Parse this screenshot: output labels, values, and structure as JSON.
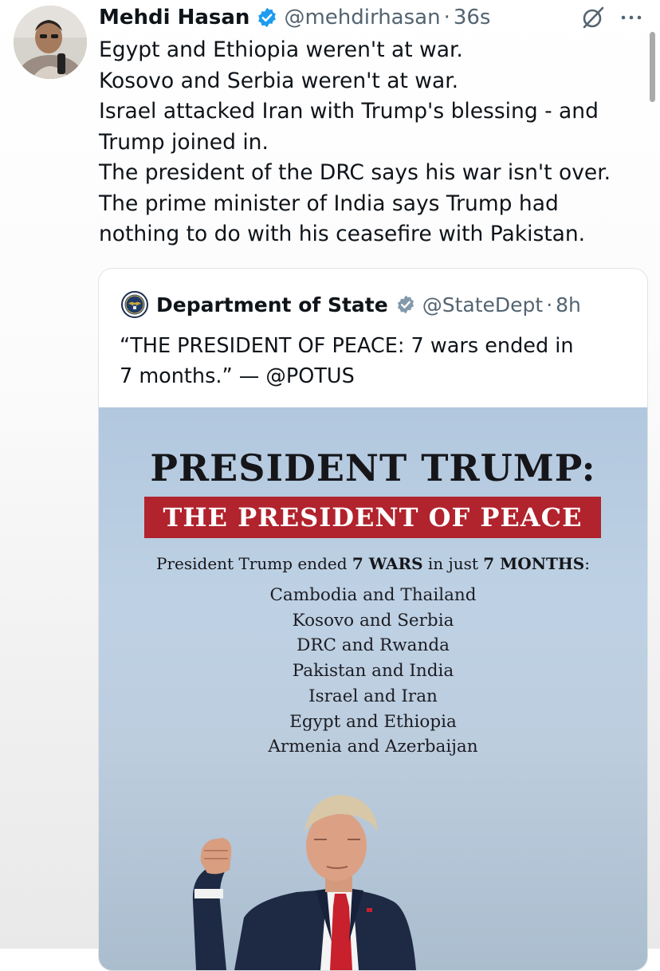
{
  "tweet": {
    "author_name": "Mehdi Hasan",
    "handle": "@mehdirhasan",
    "separator": "·",
    "time": "36s",
    "lines": [
      "Egypt and Ethiopia weren't at war.",
      "Kosovo and Serbia weren't at war.",
      "Israel attacked Iran with Trump's blessing - and",
      "Trump joined in.",
      "The president of the DRC says his war isn't over.",
      "The prime minister of India says Trump had",
      "nothing to do with his ceasefire with Pakistan."
    ]
  },
  "quoted": {
    "author_name": "Department of State",
    "handle": "@StateDept",
    "separator": "·",
    "time": "8h",
    "lines": [
      "“THE PRESIDENT OF PEACE: 7 wars ended in",
      "7 months.” — @POTUS"
    ]
  },
  "poster": {
    "title": "PRESIDENT TRUMP:",
    "banner": "THE PRESIDENT OF PEACE",
    "subtitle_parts": [
      "President Trump ended ",
      "7 WARS",
      " in just ",
      "7 MONTHS",
      ":"
    ],
    "wars": [
      "Cambodia and Thailand",
      "Kosovo and Serbia",
      "DRC and Rwanda",
      "Pakistan and India",
      "Israel and Iran",
      "Egypt and Ethiopia",
      "Armenia and Azerbaijan"
    ]
  },
  "icons": {
    "verified": "verified-badge-icon",
    "grok": "grok-icon",
    "more": "more-options-icon",
    "seal": "state-department-seal-icon"
  },
  "colors": {
    "verified_blue": "#1d9bf0",
    "gray_verified": "#829aab",
    "banner_red": "#b1232d",
    "secondary_text": "#536471"
  }
}
